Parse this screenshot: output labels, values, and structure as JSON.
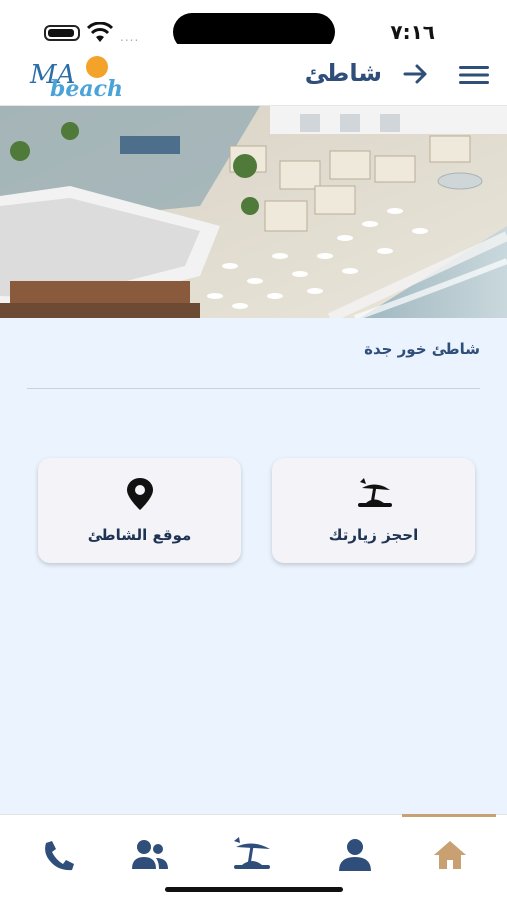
{
  "status_bar": {
    "time": "٧:١٦",
    "signal_dots": "....",
    "icons": [
      "battery-icon",
      "wifi-icon"
    ]
  },
  "header": {
    "logo_text_top": "MA",
    "logo_text_bottom": "beach",
    "title": "شاطئ",
    "icons": [
      "back-arrow-icon",
      "menu-icon"
    ]
  },
  "hero": {
    "alt": "beach-resort-image"
  },
  "content": {
    "beach_name": "شاطئ خور جدة",
    "cards": {
      "book_label": "احجز زيارتك",
      "location_label": "موقع الشاطئ"
    }
  },
  "bottom_nav": {
    "items": [
      {
        "icon": "phone-icon"
      },
      {
        "icon": "users-icon"
      },
      {
        "icon": "umbrella-icon"
      },
      {
        "icon": "user-icon"
      },
      {
        "icon": "home-icon",
        "active": true
      }
    ]
  },
  "colors": {
    "primary": "#2f4e7a",
    "accent": "#c8a072",
    "content_bg": "#eaf3fe"
  }
}
